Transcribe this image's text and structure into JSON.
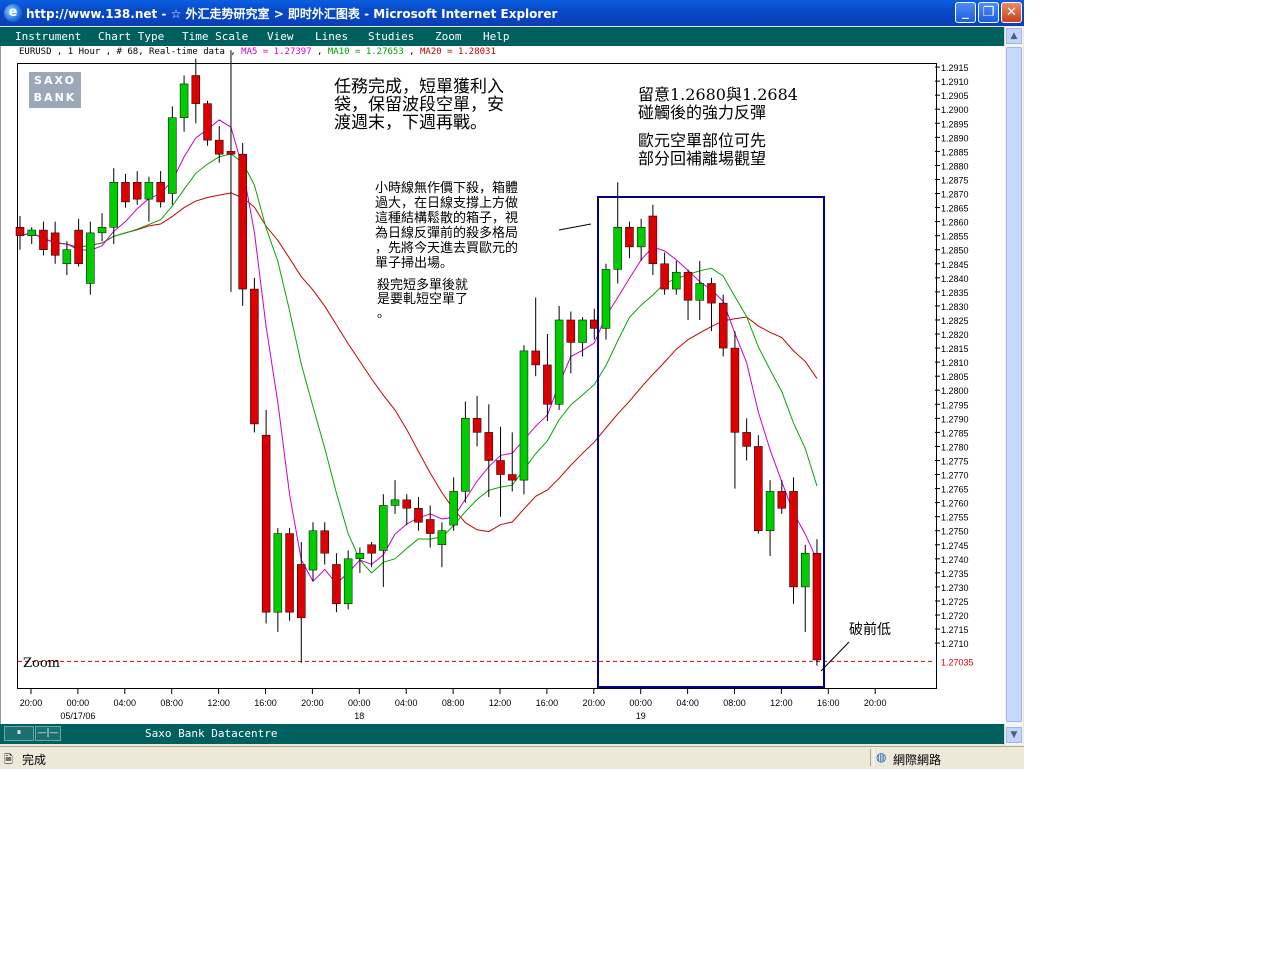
{
  "window": {
    "title": "http://www.138.net - ☆ 外汇走势研究室 > 即时外汇图表 - Microsoft Internet Explorer",
    "status": "完成",
    "zone": "網際網路"
  },
  "menu": [
    "Instrument",
    "Chart Type",
    "Time Scale",
    "View",
    "Lines",
    "Studies",
    "Zoom",
    "Help"
  ],
  "chart_header": {
    "symbol": "EURUSD , 1 Hour , # 68, Real-time data",
    "ma5": "MA5 = 1.27397",
    "ma10": "MA10 = 1.27653",
    "ma20": "MA20 = 1.28031"
  },
  "logo": {
    "line1": "SAXO",
    "line2": "BANK"
  },
  "annotations": {
    "a1": "任務完成，短單獲利入\n袋，保留波段空單，安\n渡週末，下週再戰。",
    "a2": "留意1.2680與1.2684\n碰觸後的強力反彈",
    "a3": "歐元空單部位可先\n部分回補離場觀望",
    "a4": "小時線無作價下殺，箱體\n過大，在日線支撐上方做\n這種結構鬆散的箱子，視\n為日線反彈前的殺多格局\n，先將今天進去買歐元的\n單子掃出場。",
    "a5": "殺完短多單後就\n是要軋短空單了\n。",
    "a6": "破前低"
  },
  "zoom_label": "Zoom",
  "bottom_source": "Saxo Bank Datacentre",
  "colors": {
    "up": "#00cc00",
    "down": "#dd0000",
    "ma5": "#cc00cc",
    "ma10": "#00aa00",
    "ma20": "#cc0000",
    "box": "#000080",
    "bar": "#005f5f"
  },
  "chart_data": {
    "type": "candlestick",
    "instrument": "EURUSD",
    "timeframe": "1 Hour",
    "y_ticks": [
      1.2915,
      1.291,
      1.2905,
      1.29,
      1.2895,
      1.289,
      1.2885,
      1.288,
      1.2875,
      1.287,
      1.2865,
      1.286,
      1.2855,
      1.285,
      1.2845,
      1.284,
      1.2835,
      1.283,
      1.2825,
      1.282,
      1.2815,
      1.281,
      1.2805,
      1.28,
      1.2795,
      1.279,
      1.2785,
      1.278,
      1.2775,
      1.277,
      1.2765,
      1.276,
      1.2755,
      1.275,
      1.2745,
      1.274,
      1.2735,
      1.273,
      1.2725,
      1.272,
      1.2715,
      1.271
    ],
    "current_price": "1.27035",
    "x_ticks": [
      "20:00",
      "00:00",
      "04:00",
      "08:00",
      "12:00",
      "16:00",
      "20:00",
      "00:00",
      "04:00",
      "08:00",
      "12:00",
      "16:00",
      "20:00",
      "00:00",
      "04:00",
      "08:00",
      "12:00",
      "16:00",
      "20:00"
    ],
    "x_dates": [
      {
        "at": 1,
        "label": "05/17/06"
      },
      {
        "at": 7,
        "label": "18"
      },
      {
        "at": 13,
        "label": "19"
      }
    ],
    "candles": [
      [
        1.2858,
        1.2862,
        1.285,
        1.2855
      ],
      [
        1.2855,
        1.2858,
        1.2852,
        1.2857
      ],
      [
        1.2857,
        1.286,
        1.2848,
        1.285
      ],
      [
        1.2856,
        1.286,
        1.2845,
        1.2848
      ],
      [
        1.2845,
        1.2853,
        1.2841,
        1.285
      ],
      [
        1.2857,
        1.2861,
        1.2844,
        1.2845
      ],
      [
        1.2838,
        1.286,
        1.2834,
        1.2856
      ],
      [
        1.2856,
        1.2863,
        1.2853,
        1.2858
      ],
      [
        1.2858,
        1.2879,
        1.2852,
        1.2874
      ],
      [
        1.2874,
        1.2877,
        1.2865,
        1.2867
      ],
      [
        1.2874,
        1.2878,
        1.2866,
        1.2868
      ],
      [
        1.2868,
        1.2876,
        1.286,
        1.2874
      ],
      [
        1.2874,
        1.2878,
        1.2865,
        1.2867
      ],
      [
        1.287,
        1.2901,
        1.2866,
        1.2897
      ],
      [
        1.2897,
        1.2912,
        1.2892,
        1.2909
      ],
      [
        1.2912,
        1.2918,
        1.2895,
        1.2902
      ],
      [
        1.2902,
        1.2903,
        1.2887,
        1.2889
      ],
      [
        1.2889,
        1.2894,
        1.2881,
        1.2884
      ],
      [
        1.2885,
        1.2921,
        1.2835,
        1.2884
      ],
      [
        1.2884,
        1.2888,
        1.283,
        1.2836
      ],
      [
        1.2836,
        1.284,
        1.2785,
        1.2788
      ],
      [
        1.2784,
        1.2793,
        1.2717,
        1.2721
      ],
      [
        1.2721,
        1.2751,
        1.2714,
        1.2749
      ],
      [
        1.2749,
        1.2751,
        1.2718,
        1.2721
      ],
      [
        1.2738,
        1.2746,
        1.2703,
        1.2719
      ],
      [
        1.2736,
        1.2753,
        1.2732,
        1.275
      ],
      [
        1.275,
        1.2753,
        1.2738,
        1.2742
      ],
      [
        1.2738,
        1.2742,
        1.2721,
        1.2724
      ],
      [
        1.2724,
        1.2743,
        1.2722,
        1.274
      ],
      [
        1.274,
        1.2744,
        1.2735,
        1.2742
      ],
      [
        1.2745,
        1.2746,
        1.2737,
        1.2742
      ],
      [
        1.2743,
        1.2763,
        1.273,
        1.2759
      ],
      [
        1.2759,
        1.2768,
        1.2756,
        1.2761
      ],
      [
        1.2761,
        1.2763,
        1.2752,
        1.2758
      ],
      [
        1.2758,
        1.2762,
        1.275,
        1.2753
      ],
      [
        1.2754,
        1.2759,
        1.2744,
        1.2749
      ],
      [
        1.2745,
        1.2753,
        1.2737,
        1.275
      ],
      [
        1.2752,
        1.2769,
        1.275,
        1.2764
      ],
      [
        1.2764,
        1.2796,
        1.276,
        1.279
      ],
      [
        1.279,
        1.2798,
        1.278,
        1.2785
      ],
      [
        1.2785,
        1.2795,
        1.2762,
        1.2775
      ],
      [
        1.2775,
        1.2787,
        1.2755,
        1.277
      ],
      [
        1.277,
        1.2785,
        1.2764,
        1.2768
      ],
      [
        1.2768,
        1.2816,
        1.2763,
        1.2814
      ],
      [
        1.2814,
        1.2833,
        1.2805,
        1.2809
      ],
      [
        1.2809,
        1.282,
        1.2789,
        1.2795
      ],
      [
        1.2795,
        1.283,
        1.2793,
        1.2825
      ],
      [
        1.2825,
        1.2828,
        1.2806,
        1.2817
      ],
      [
        1.2817,
        1.2826,
        1.2812,
        1.2825
      ],
      [
        1.2825,
        1.2829,
        1.2818,
        1.2822
      ],
      [
        1.2822,
        1.2845,
        1.2818,
        1.2843
      ],
      [
        1.2843,
        1.2874,
        1.2838,
        1.2858
      ],
      [
        1.2858,
        1.286,
        1.2847,
        1.2851
      ],
      [
        1.2851,
        1.2861,
        1.2846,
        1.2858
      ],
      [
        1.2862,
        1.2866,
        1.2841,
        1.2845
      ],
      [
        1.2845,
        1.2849,
        1.2834,
        1.2836
      ],
      [
        1.2836,
        1.2846,
        1.2834,
        1.2842
      ],
      [
        1.2842,
        1.2843,
        1.2825,
        1.2832
      ],
      [
        1.2832,
        1.2846,
        1.2825,
        1.2838
      ],
      [
        1.2838,
        1.284,
        1.2821,
        1.2831
      ],
      [
        1.2831,
        1.2834,
        1.2812,
        1.2815
      ],
      [
        1.2815,
        1.2821,
        1.2765,
        1.2785
      ],
      [
        1.2785,
        1.279,
        1.2775,
        1.278
      ],
      [
        1.278,
        1.2784,
        1.2749,
        1.275
      ],
      [
        1.275,
        1.2768,
        1.2741,
        1.2764
      ],
      [
        1.2764,
        1.2768,
        1.2756,
        1.2758
      ],
      [
        1.2764,
        1.2769,
        1.2724,
        1.273
      ],
      [
        1.273,
        1.2745,
        1.2714,
        1.2742
      ],
      [
        1.2742,
        1.2747,
        1.2702,
        1.2704
      ]
    ]
  }
}
